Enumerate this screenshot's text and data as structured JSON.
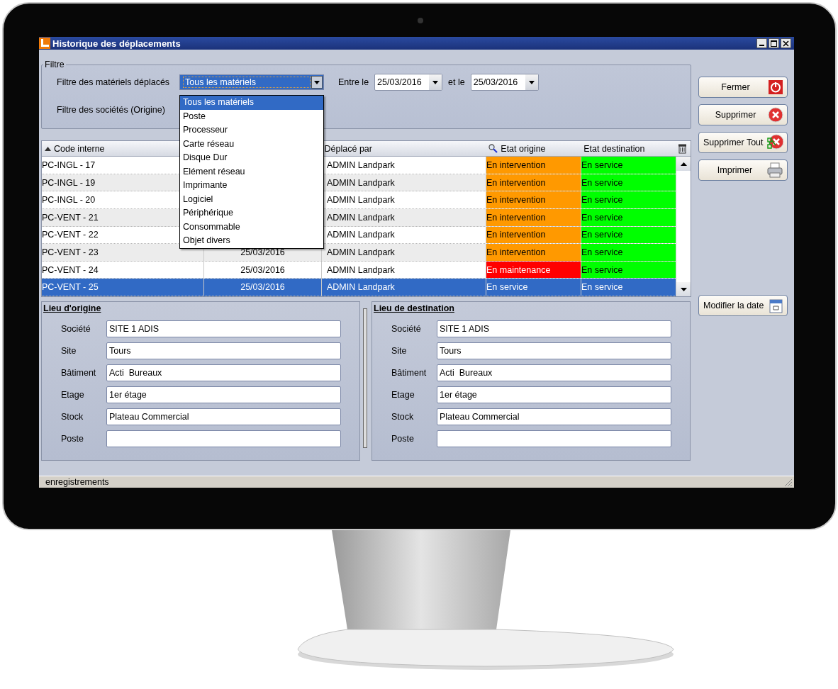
{
  "window": {
    "title": "Historique des déplacements"
  },
  "filter": {
    "title": "Filtre",
    "material_label": "Filtre des matériels déplacés",
    "material_value": "Tous les matériels",
    "expanded": true,
    "options": [
      {
        "label": "Tous les matériels",
        "selected": true
      },
      {
        "label": "Poste",
        "selected": false
      },
      {
        "label": "Processeur",
        "selected": false
      },
      {
        "label": "Carte réseau",
        "selected": false
      },
      {
        "label": "Disque Dur",
        "selected": false
      },
      {
        "label": "Elément réseau",
        "selected": false
      },
      {
        "label": "Imprimante",
        "selected": false
      },
      {
        "label": "Logiciel",
        "selected": false
      },
      {
        "label": "Périphérique",
        "selected": false
      },
      {
        "label": "Consommable",
        "selected": false
      },
      {
        "label": "Objet divers",
        "selected": false
      }
    ],
    "company_label": "Filtre des sociétés (Origine)",
    "between_label": "Entre le",
    "date_from": "25/03/2016",
    "and_label": "et le",
    "date_to": "25/03/2016"
  },
  "table": {
    "columns": [
      {
        "label": "Code interne",
        "sorted": true
      },
      {
        "label": "Déplacé par",
        "sorted": false
      },
      {
        "label": "Etat origine",
        "sorted": false
      },
      {
        "label": "Etat destination",
        "sorted": false
      }
    ],
    "rows": [
      {
        "code": "PC-INGL - 17",
        "moved_by": "ADMIN Landpark",
        "origin_state": {
          "text": "En intervention",
          "color": "#ff9900"
        },
        "destination_state": {
          "text": "En service",
          "color": "#00ff00"
        },
        "selected": false
      },
      {
        "code": "PC-INGL - 19",
        "moved_by": "ADMIN Landpark",
        "origin_state": {
          "text": "En intervention",
          "color": "#ff9900"
        },
        "destination_state": {
          "text": "En service",
          "color": "#00ff00"
        },
        "selected": false
      },
      {
        "code": "PC-INGL - 20",
        "moved_by": "ADMIN Landpark",
        "origin_state": {
          "text": "En intervention",
          "color": "#ff9900"
        },
        "destination_state": {
          "text": "En service",
          "color": "#00ff00"
        },
        "selected": false
      },
      {
        "code": "PC-VENT - 21",
        "moved_by": "ADMIN Landpark",
        "origin_state": {
          "text": "En intervention",
          "color": "#ff9900"
        },
        "destination_state": {
          "text": "En service",
          "color": "#00ff00"
        },
        "selected": false
      },
      {
        "code": "PC-VENT - 22",
        "moved_by": "ADMIN Landpark",
        "origin_state": {
          "text": "En intervention",
          "color": "#ff9900"
        },
        "destination_state": {
          "text": "En service",
          "color": "#00ff00"
        },
        "selected": false
      },
      {
        "code": "PC-VENT - 23",
        "date": "25/03/2016",
        "moved_by": "ADMIN Landpark",
        "origin_state": {
          "text": "En intervention",
          "color": "#ff9900"
        },
        "destination_state": {
          "text": "En service",
          "color": "#00ff00"
        },
        "selected": false
      },
      {
        "code": "PC-VENT - 24",
        "date": "25/03/2016",
        "moved_by": "ADMIN Landpark",
        "origin_state": {
          "text": "En maintenance",
          "color": "#ff0000"
        },
        "destination_state": {
          "text": "En service",
          "color": "#00ff00"
        },
        "selected": false
      },
      {
        "code": "PC-VENT - 25",
        "date": "25/03/2016",
        "moved_by": "ADMIN Landpark",
        "origin_state": {
          "text": "En service"
        },
        "destination_state": {
          "text": "En service"
        },
        "selected": true
      }
    ]
  },
  "actions": [
    {
      "label": "Fermer",
      "kind": "power"
    },
    {
      "label": "Supprimer",
      "kind": "delete"
    },
    {
      "label": "Supprimer Tout",
      "kind": "delete-all"
    },
    {
      "label": "Imprimer",
      "kind": "print"
    }
  ],
  "date_button": {
    "label": "Modifier la date",
    "kind": "calendar"
  },
  "origin": {
    "title": "Lieu d'origine",
    "fields": [
      {
        "label": "Société",
        "value": "SITE 1 ADIS"
      },
      {
        "label": "Site",
        "value": "Tours"
      },
      {
        "label": "Bâtiment",
        "value": "Acti  Bureaux"
      },
      {
        "label": "Etage",
        "value": "1er étage"
      },
      {
        "label": "Stock",
        "value": "Plateau Commercial"
      },
      {
        "label": "Poste"
      }
    ]
  },
  "destination": {
    "title": "Lieu de destination",
    "fields": [
      {
        "label": "Société",
        "value": "SITE 1 ADIS"
      },
      {
        "label": "Site",
        "value": "Tours"
      },
      {
        "label": "Bâtiment",
        "value": "Acti  Bureaux"
      },
      {
        "label": "Etage",
        "value": "1er étage"
      },
      {
        "label": "Stock",
        "value": "Plateau Commercial"
      },
      {
        "label": "Poste"
      }
    ]
  },
  "status_bar": {
    "text": "enregistrements"
  }
}
